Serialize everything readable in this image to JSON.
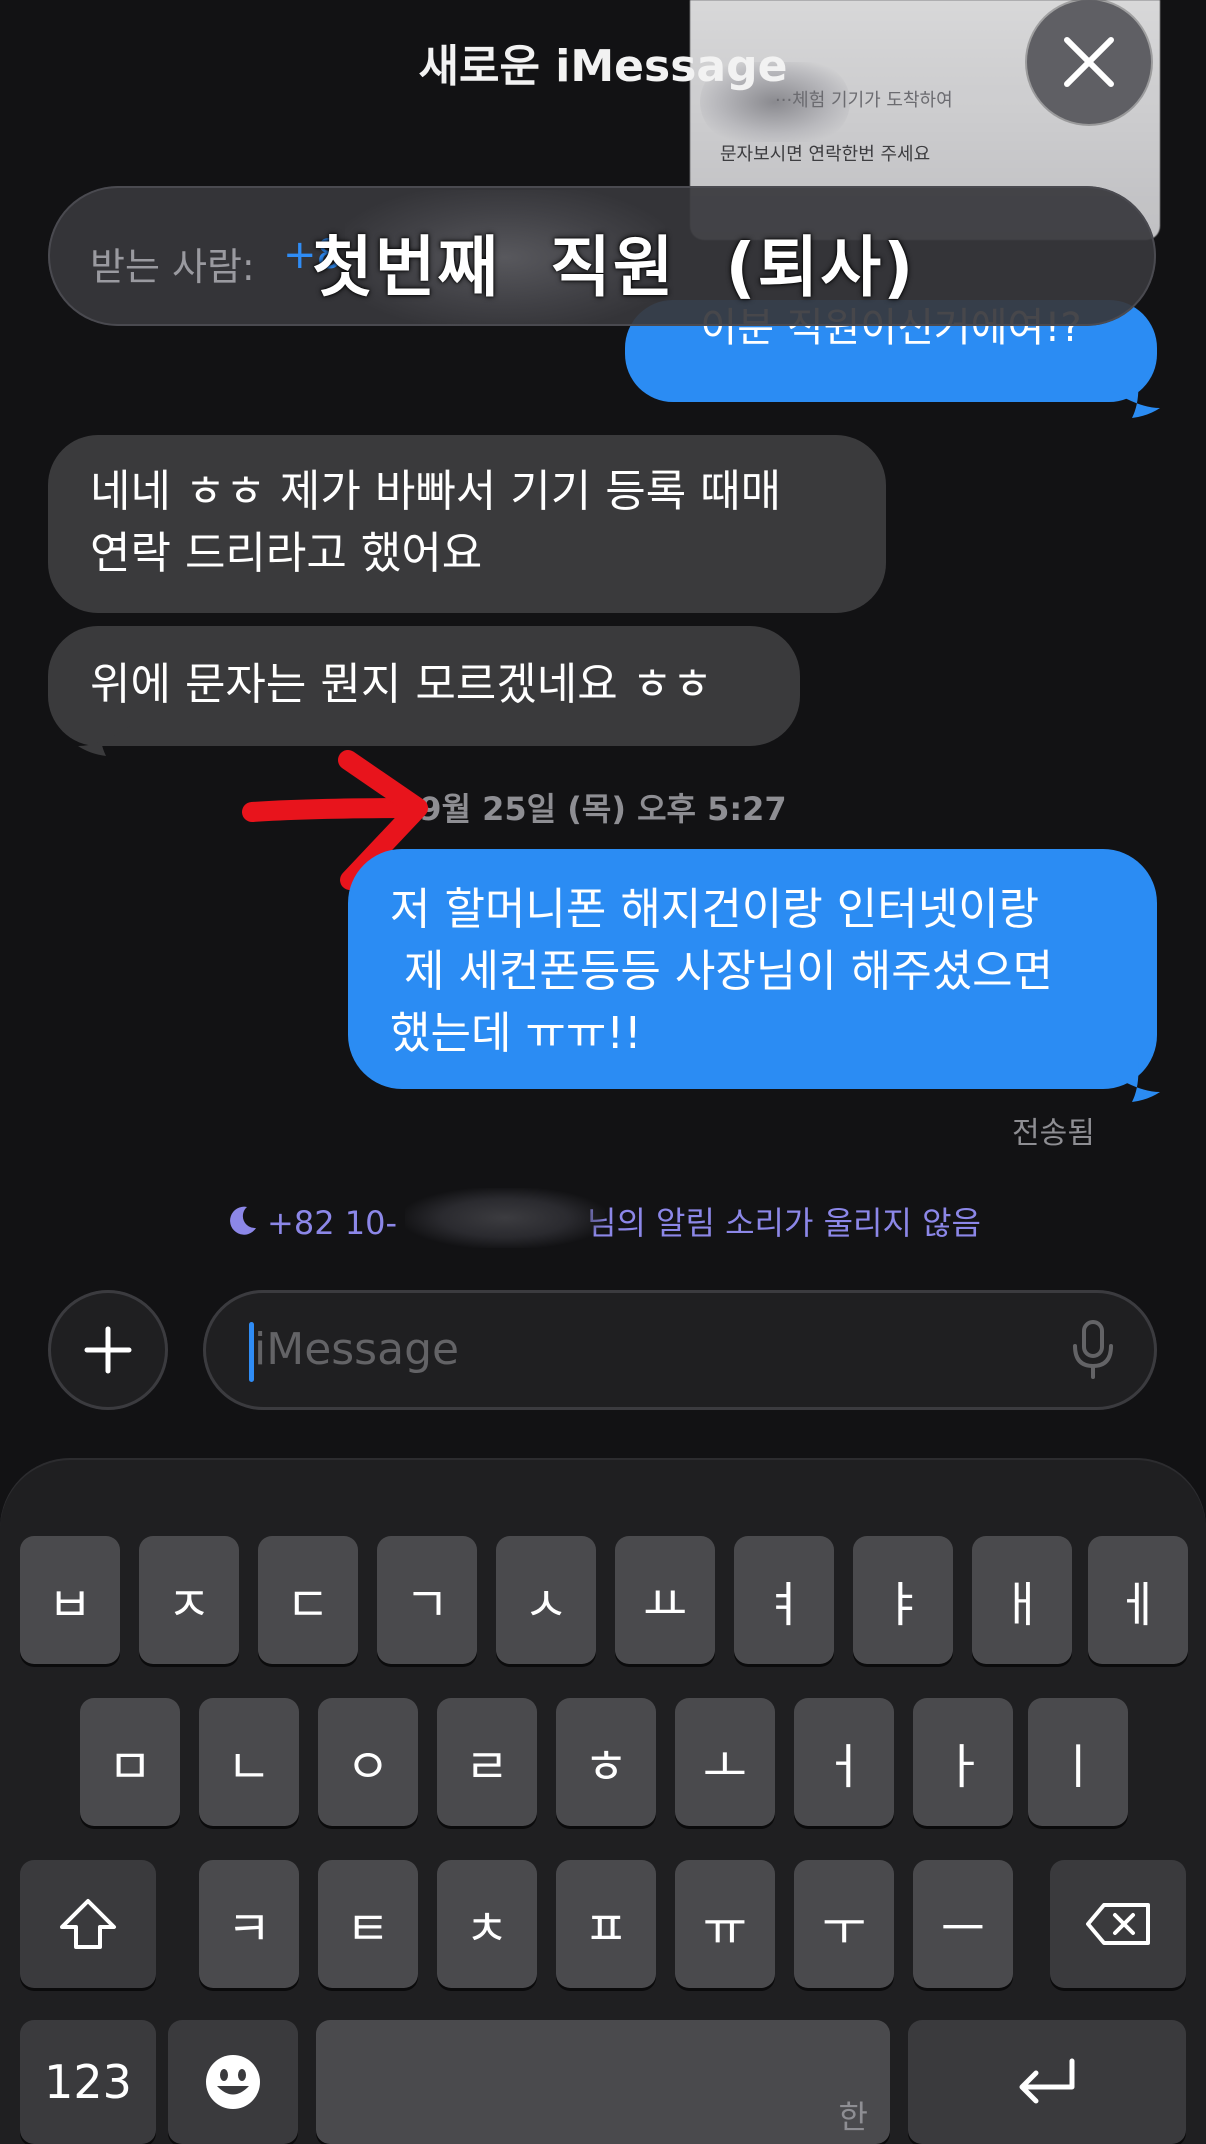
{
  "header": {
    "title": "새로운 iMessage",
    "close_icon": "close-icon"
  },
  "notification_preview": {
    "line1": "···체험 기기가 도착하여",
    "line2": "문자보시면 연락한번 주세요"
  },
  "recipient": {
    "label": "받는 사람:",
    "value_prefix": "+8",
    "overlay_text": "첫번째  직원  (퇴사)"
  },
  "messages": [
    {
      "direction": "outgoing",
      "text": "이분 직원이신거에여!?"
    },
    {
      "direction": "incoming",
      "lines": [
        "네네 ㅎㅎ 제가 바빠서 기기 등록 때매",
        "연락 드리라고 했어요"
      ]
    },
    {
      "direction": "incoming",
      "text": "위에 문자는 뭔지 모르겠네요 ㅎㅎ"
    },
    {
      "direction": "outgoing",
      "lines": [
        "저 할머니폰 해지건이랑 인터넷이랑",
        " 제 세컨폰등등 사장님이 해주셨으면",
        "했는데 ㅠㅠ!!"
      ]
    }
  ],
  "timestamp": "9월 25일 (목) 오후 5:27",
  "delivered": "전송됨",
  "focus_notice": {
    "icon": "moon-icon",
    "prefix": "+82 10-",
    "suffix": "님의 알림 소리가 울리지 않음"
  },
  "input": {
    "placeholder": "iMessage",
    "plus_icon": "plus-icon",
    "mic_icon": "mic-icon"
  },
  "keyboard": {
    "row1": [
      "ㅂ",
      "ㅈ",
      "ㄷ",
      "ㄱ",
      "ㅅ",
      "ㅛ",
      "ㅕ",
      "ㅑ",
      "ㅐ",
      "ㅔ"
    ],
    "row2": [
      "ㅁ",
      "ㄴ",
      "ㅇ",
      "ㄹ",
      "ㅎ",
      "ㅗ",
      "ㅓ",
      "ㅏ",
      "ㅣ"
    ],
    "row3": [
      "ㅋ",
      "ㅌ",
      "ㅊ",
      "ㅍ",
      "ㅠ",
      "ㅜ",
      "ㅡ"
    ],
    "numbers_key": "123",
    "space_hint": "한",
    "shift_icon": "shift-icon",
    "delete_icon": "delete-icon",
    "emoji_icon": "emoji-icon",
    "return_icon": "return-icon"
  },
  "colors": {
    "background": "#121214",
    "outgoing_bubble": "#2b8cf3",
    "incoming_bubble": "#3a3a3c",
    "focus_text": "#8c87e8",
    "annotation_arrow": "#e8141c"
  }
}
